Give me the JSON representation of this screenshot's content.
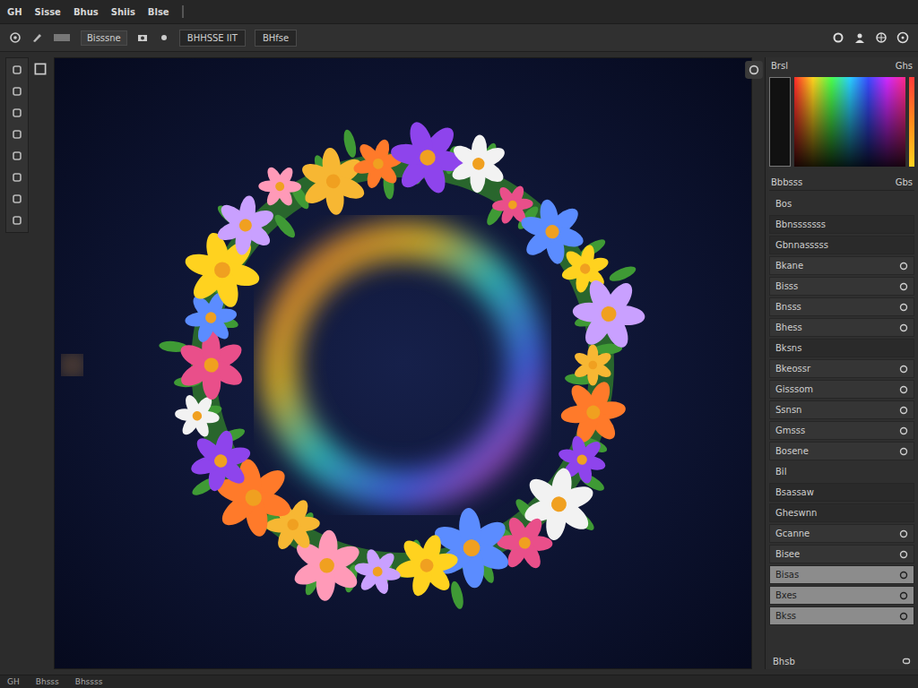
{
  "menu": [
    {
      "label": "GH"
    },
    {
      "label": "Sisse"
    },
    {
      "label": "Bhus"
    },
    {
      "label": "Shiis"
    },
    {
      "label": "Blse"
    }
  ],
  "toolbar": {
    "buttons": [
      {
        "label": "Bisssne"
      }
    ],
    "fields": [
      {
        "label": "BHHSSE IIT"
      },
      {
        "label": "BHfse"
      }
    ]
  },
  "panel": {
    "title": "Brsl",
    "value": "Ghs",
    "section": "Bbbsss",
    "section_value": "Gbs",
    "rows": [
      {
        "label": "Bos",
        "kind": "plain",
        "selected": false
      },
      {
        "label": "Bbnsssssss",
        "kind": "field",
        "selected": false
      },
      {
        "label": "Gbnnasssss",
        "kind": "field",
        "selected": false
      },
      {
        "label": "Bkane",
        "kind": "toggle",
        "selected": false
      },
      {
        "label": "Bisss",
        "kind": "toggle",
        "selected": false
      },
      {
        "label": "Bnsss",
        "kind": "toggle",
        "selected": false
      },
      {
        "label": "Bhess",
        "kind": "toggle",
        "selected": false
      },
      {
        "label": "Bksns",
        "kind": "field",
        "selected": false
      },
      {
        "label": "Bkeossr",
        "kind": "toggle",
        "selected": false
      },
      {
        "label": "Gisssom",
        "kind": "toggle",
        "selected": false
      },
      {
        "label": "Ssnsn",
        "kind": "toggle",
        "selected": false
      },
      {
        "label": "Gmsss",
        "kind": "toggle",
        "selected": false
      },
      {
        "label": "Bosene",
        "kind": "toggle",
        "selected": false
      },
      {
        "label": "Bil",
        "kind": "plain",
        "selected": false
      },
      {
        "label": "Bsassaw",
        "kind": "field",
        "selected": false
      },
      {
        "label": "Gheswnn",
        "kind": "field",
        "selected": false
      },
      {
        "label": "Gcanne",
        "kind": "toggle",
        "selected": false
      },
      {
        "label": "Bisee",
        "kind": "toggle",
        "selected": false
      },
      {
        "label": "Bisas",
        "kind": "toggle",
        "selected": true
      },
      {
        "label": "Bxes",
        "kind": "toggle",
        "selected": true
      },
      {
        "label": "Bkss",
        "kind": "toggle",
        "selected": true
      }
    ],
    "footer": "Bhsb"
  },
  "status_bar": [
    {
      "label": "GH"
    },
    {
      "label": "Bhsss"
    },
    {
      "label": "Bhssss"
    }
  ]
}
